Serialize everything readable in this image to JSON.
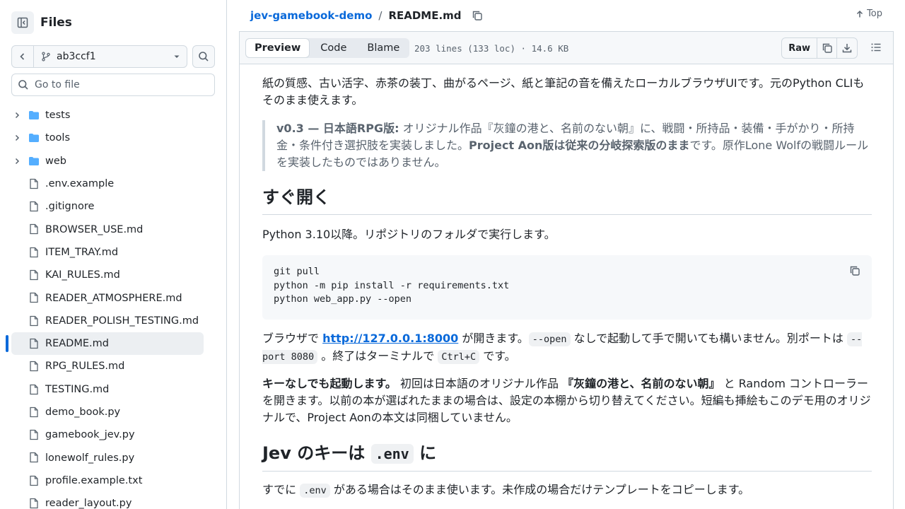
{
  "sidebar": {
    "title": "Files",
    "branch": "ab3ccf1",
    "goto_placeholder": "Go to file",
    "items": [
      {
        "name": "tests",
        "type": "folder"
      },
      {
        "name": "tools",
        "type": "folder"
      },
      {
        "name": "web",
        "type": "folder"
      },
      {
        "name": ".env.example",
        "type": "file"
      },
      {
        "name": ".gitignore",
        "type": "file"
      },
      {
        "name": "BROWSER_USE.md",
        "type": "file"
      },
      {
        "name": "ITEM_TRAY.md",
        "type": "file"
      },
      {
        "name": "KAI_RULES.md",
        "type": "file"
      },
      {
        "name": "READER_ATMOSPHERE.md",
        "type": "file"
      },
      {
        "name": "READER_POLISH_TESTING.md",
        "type": "file"
      },
      {
        "name": "README.md",
        "type": "file",
        "active": true
      },
      {
        "name": "RPG_RULES.md",
        "type": "file"
      },
      {
        "name": "TESTING.md",
        "type": "file"
      },
      {
        "name": "demo_book.py",
        "type": "file"
      },
      {
        "name": "gamebook_jev.py",
        "type": "file"
      },
      {
        "name": "lonewolf_rules.py",
        "type": "file"
      },
      {
        "name": "profile.example.txt",
        "type": "file"
      },
      {
        "name": "reader_layout.py",
        "type": "file"
      }
    ]
  },
  "header": {
    "repo": "jev-gamebook-demo",
    "separator": "/",
    "file": "README.md",
    "top_label": "Top"
  },
  "file_header": {
    "tabs": [
      "Preview",
      "Code",
      "Blame"
    ],
    "meta": "203 lines (133 loc) · 14.6 KB",
    "raw_label": "Raw"
  },
  "readme": {
    "intro": "紙の質感、古い活字、赤茶の装丁、曲がるページ、紙と筆記の音を備えたローカルブラウザUIです。元のPython CLIもそのまま使えます。",
    "quote_bold1": "v0.3 — 日本語RPG版:",
    "quote_text1": " オリジナル作品『灰鐘の港と、名前のない朝』に、戦闘・所持品・装備・手がかり・所持金・条件付き選択肢を実装しました。",
    "quote_bold2": "Project Aon版は従来の分岐探索版のまま",
    "quote_text2": "です。原作Lone Wolfの戦闘ルールを実装したものではありません。",
    "h_open": "すぐ開く",
    "python_req": "Python 3.10以降。リポジトリのフォルダで実行します。",
    "code_lines": [
      "git pull",
      "python -m pip install -r requirements.txt",
      "python web_app.py --open"
    ],
    "p3_a": "ブラウザで ",
    "p3_link": "http://127.0.0.1:8000",
    "p3_b": " が開きます。",
    "p3_code1": "--open",
    "p3_c": " なしで起動して手で開いても構いません。別ポートは ",
    "p3_code2": "--port 8080",
    "p3_d": " 。終了はターミナルで ",
    "p3_code3": "Ctrl+C",
    "p3_e": " です。",
    "p4_bold1": "キーなしでも起動します。",
    "p4_a": " 初回は日本語のオリジナル作品 ",
    "p4_bold2": "『灰鐘の港と、名前のない朝』",
    "p4_b": " と Random コントローラーを開きます。以前の本が選ばれたままの場合は、設定の本棚から切り替えてください。短編も挿絵もこのデモ用のオリジナルで、Project Aonの本文は同梱していません。",
    "h_key_a": "Jev のキーは ",
    "h_key_code": ".env",
    "h_key_b": " に",
    "p5_a": "すでに ",
    "p5_code": ".env",
    "p5_b": " がある場合はそのまま使います。未作成の場合だけテンプレートをコピーします。"
  }
}
